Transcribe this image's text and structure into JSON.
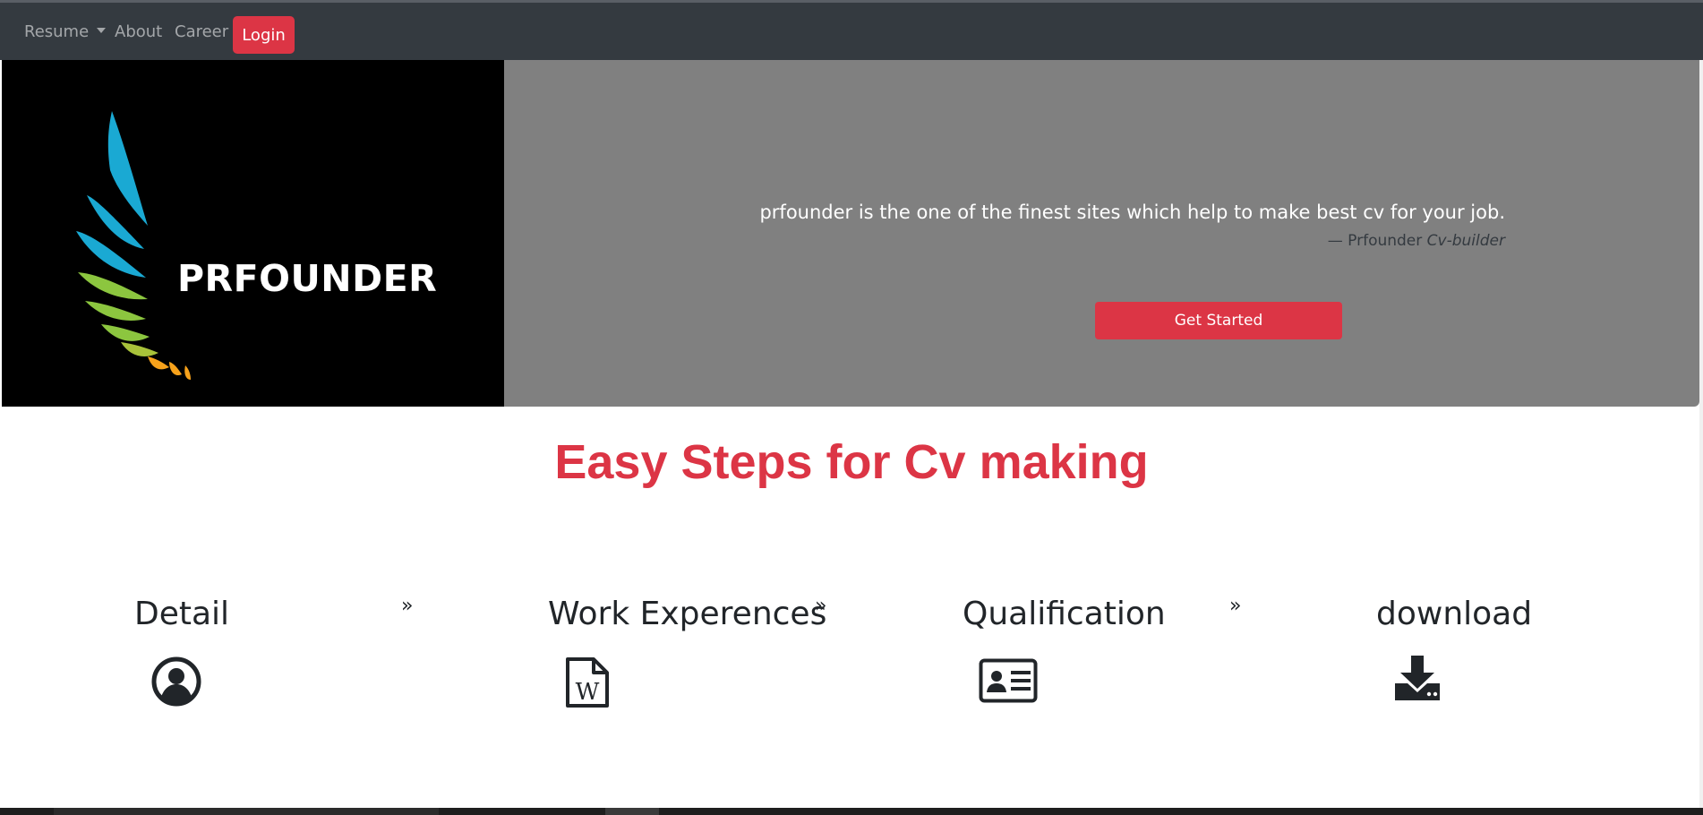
{
  "navbar": {
    "resume_label": "Resume",
    "about_label": "About",
    "career_label": "Career",
    "login_label": "Login"
  },
  "hero": {
    "logo_text": "PRFOUNDER",
    "quote": "prfounder is the one of the finest sites which help to make best cv for your job.",
    "quote_author": "— Prfounder",
    "quote_source": "Cv-builder",
    "cta_label": "Get Started"
  },
  "steps_section": {
    "title": "Easy Steps for Cv making",
    "steps": [
      {
        "title": "Detail",
        "icon": "user-circle-icon"
      },
      {
        "title": "Work Experences",
        "icon": "word-file-icon"
      },
      {
        "title": "Qualification",
        "icon": "id-card-icon"
      },
      {
        "title": "download",
        "icon": "download-icon"
      }
    ],
    "separator": "»"
  },
  "colors": {
    "navbar_bg": "#343a40",
    "accent_red": "#dc3545",
    "hero_bg": "#808080",
    "logo_bg": "#000000",
    "text_dark": "#212529"
  }
}
